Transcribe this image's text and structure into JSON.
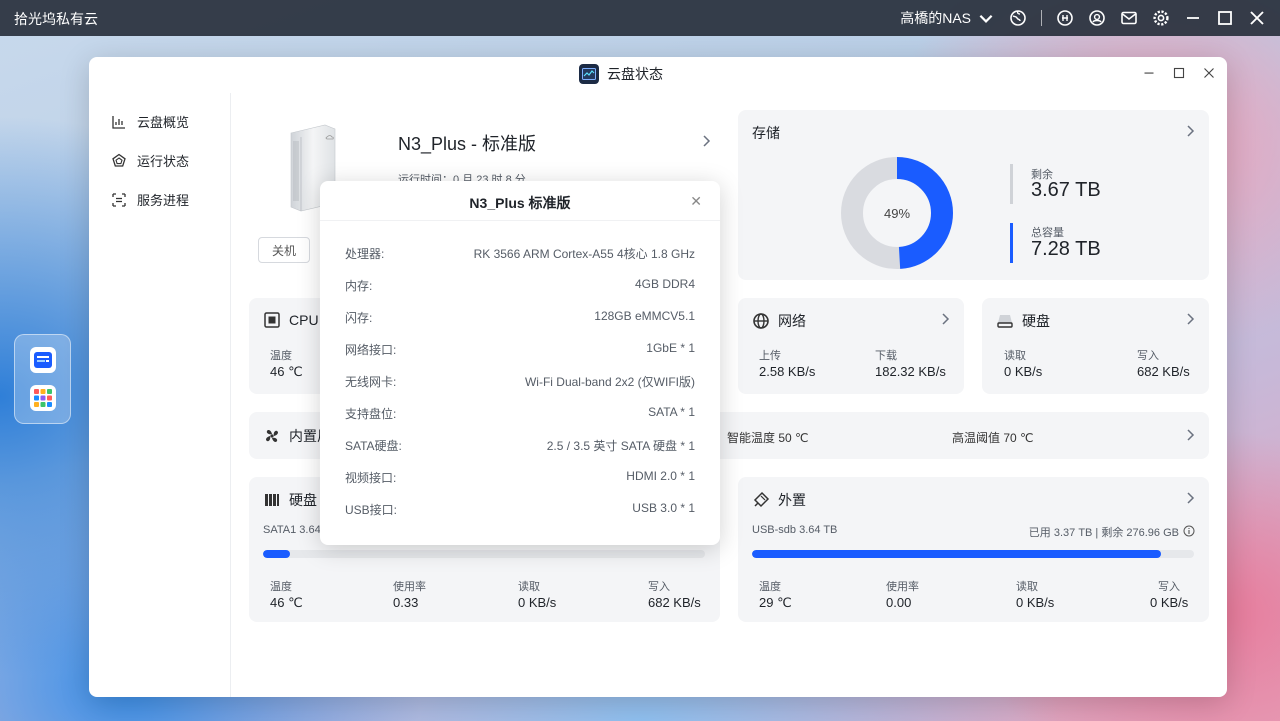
{
  "topbar": {
    "app_title": "拾光坞私有云",
    "nas_name": "高橋的NAS"
  },
  "window": {
    "title": "云盘状态"
  },
  "sidebar": {
    "items": [
      {
        "label": "云盘概览",
        "icon": "chart-icon"
      },
      {
        "label": "运行状态",
        "icon": "pentagon-icon"
      },
      {
        "label": "服务进程",
        "icon": "process-icon"
      }
    ]
  },
  "device": {
    "name": "N3_Plus - 标准版",
    "runtime": "运行时间：0 月 23 时 8 分",
    "shutdown_label": "关机"
  },
  "storage": {
    "title": "存储",
    "used_percent": 49,
    "used_percent_label": "49%",
    "remaining_label": "剩余",
    "remaining_value": "3.67 TB",
    "total_label": "总容量",
    "total_value": "7.28 TB",
    "colors": {
      "used": "#1a5cff",
      "free": "#d9dbe0"
    }
  },
  "cpu": {
    "title": "CPU",
    "temp_label": "温度",
    "temp_value": "46 ℃"
  },
  "network": {
    "title": "网络",
    "upload_label": "上传",
    "upload_value": "2.58 KB/s",
    "download_label": "下载",
    "download_value": "182.32 KB/s"
  },
  "disk_io": {
    "title": "硬盘",
    "read_label": "读取",
    "read_value": "0 KB/s",
    "write_label": "写入",
    "write_value": "682 KB/s"
  },
  "fan": {
    "title": "内置风扇",
    "smart_temp": "智能温度 50 ℃",
    "high_temp": "高温阈值 70 ℃"
  },
  "hdd": {
    "title": "硬盘",
    "disk_label": "SATA1 3.64 TB",
    "used_fraction": 0.06,
    "temp_label": "温度",
    "temp_value": "46 ℃",
    "usage_label": "使用率",
    "usage_value": "0.33",
    "read_label": "读取",
    "read_value": "0 KB/s",
    "write_label": "写入",
    "write_value": "682 KB/s"
  },
  "external": {
    "title": "外置",
    "disk_label": "USB-sdb 3.64 TB",
    "summary": "已用 3.37 TB | 剩余 276.96 GB",
    "used_fraction": 0.926,
    "temp_label": "温度",
    "temp_value": "29 ℃",
    "usage_label": "使用率",
    "usage_value": "0.00",
    "read_label": "读取",
    "read_value": "0 KB/s",
    "write_label": "写入",
    "write_value": "0 KB/s"
  },
  "popup": {
    "title": "N3_Plus 标准版",
    "specs": [
      {
        "k": "处理器:",
        "v": "RK 3566 ARM Cortex-A55 4核心 1.8 GHz"
      },
      {
        "k": "内存:",
        "v": "4GB DDR4"
      },
      {
        "k": "闪存:",
        "v": "128GB eMMCV5.1"
      },
      {
        "k": "网络接口:",
        "v": "1GbE * 1"
      },
      {
        "k": "无线网卡:",
        "v": "Wi-Fi Dual-band 2x2 (仅WIFI版)"
      },
      {
        "k": "支持盘位:",
        "v": "SATA * 1"
      },
      {
        "k": "SATA硬盘:",
        "v": "2.5 / 3.5 英寸 SATA 硬盘 * 1"
      },
      {
        "k": "视频接口:",
        "v": "HDMI 2.0 * 1"
      },
      {
        "k": "USB接口:",
        "v": "USB 3.0 * 1"
      }
    ]
  }
}
